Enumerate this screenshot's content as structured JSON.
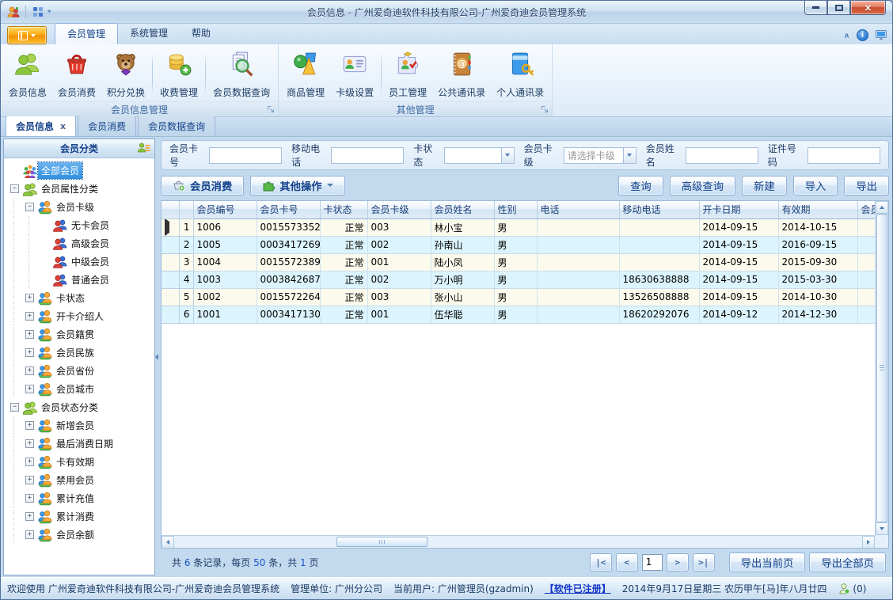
{
  "colors": {
    "accent": "#2f8fe0",
    "selection": "#3d9be9",
    "link": "#1436c8",
    "row_odd": "#fbfaec",
    "row_even": "#dcf4fd",
    "app_button": "#fcae12"
  },
  "titlebar": {
    "title": "会员信息 - 广州爱奇迪软件科技有限公司-广州爱奇迪会员管理系统"
  },
  "ribbon": {
    "tabs": [
      {
        "label": "会员管理",
        "active": true
      },
      {
        "label": "系统管理",
        "active": false
      },
      {
        "label": "帮助",
        "active": false
      }
    ],
    "groups": [
      {
        "label": "会员信息管理",
        "buttons": [
          {
            "label": "会员信息",
            "icon": "members-icon",
            "sep_after": false
          },
          {
            "label": "会员消费",
            "icon": "basket-icon",
            "sep_after": false
          },
          {
            "label": "积分兑换",
            "icon": "teddy-bear-icon",
            "sep_after": true
          },
          {
            "label": "收费管理",
            "icon": "coins-icon",
            "sep_after": true
          },
          {
            "label": "会员数据查询",
            "icon": "doc-search-icon",
            "sep_after": false
          }
        ]
      },
      {
        "label": "其他管理",
        "buttons": [
          {
            "label": "商品管理",
            "icon": "goods-icon",
            "sep_after": false
          },
          {
            "label": "卡级设置",
            "icon": "card-icon",
            "sep_after": true
          },
          {
            "label": "员工管理",
            "icon": "staff-icon",
            "sep_after": false
          },
          {
            "label": "公共通讯录",
            "icon": "address-book-icon",
            "sep_after": false
          },
          {
            "label": "个人通讯录",
            "icon": "book-key-icon",
            "sep_after": false
          }
        ]
      }
    ]
  },
  "doc_tabs": [
    {
      "label": "会员信息",
      "active": true,
      "closable": true
    },
    {
      "label": "会员消费",
      "active": false,
      "closable": false
    },
    {
      "label": "会员数据查询",
      "active": false,
      "closable": false
    }
  ],
  "sidebar": {
    "header": "会员分类",
    "tree": [
      {
        "label": "全部会员",
        "level": 0,
        "icon": "people-multi",
        "expand": "none",
        "selected": true
      },
      {
        "label": "会员属性分类",
        "level": 0,
        "icon": "people-green",
        "expand": "minus",
        "selected": false
      },
      {
        "label": "会员卡级",
        "level": 1,
        "icon": "people-pair",
        "expand": "minus",
        "selected": false
      },
      {
        "label": "无卡会员",
        "level": 2,
        "icon": "people-red",
        "expand": "none",
        "selected": false
      },
      {
        "label": "高级会员",
        "level": 2,
        "icon": "people-red",
        "expand": "none",
        "selected": false
      },
      {
        "label": "中级会员",
        "level": 2,
        "icon": "people-red",
        "expand": "none",
        "selected": false
      },
      {
        "label": "普通会员",
        "level": 2,
        "icon": "people-red",
        "expand": "none",
        "selected": false
      },
      {
        "label": "卡状态",
        "level": 1,
        "icon": "people-pair",
        "expand": "plus",
        "selected": false
      },
      {
        "label": "开卡介绍人",
        "level": 1,
        "icon": "people-pair",
        "expand": "plus",
        "selected": false
      },
      {
        "label": "会员籍贯",
        "level": 1,
        "icon": "people-pair",
        "expand": "plus",
        "selected": false
      },
      {
        "label": "会员民族",
        "level": 1,
        "icon": "people-pair",
        "expand": "plus",
        "selected": false
      },
      {
        "label": "会员省份",
        "level": 1,
        "icon": "people-pair",
        "expand": "plus",
        "selected": false
      },
      {
        "label": "会员城市",
        "level": 1,
        "icon": "people-pair",
        "expand": "plus",
        "selected": false
      },
      {
        "label": "会员状态分类",
        "level": 0,
        "icon": "people-green",
        "expand": "minus",
        "selected": false
      },
      {
        "label": "新增会员",
        "level": 1,
        "icon": "people-pair",
        "expand": "plus",
        "selected": false
      },
      {
        "label": "最后消费日期",
        "level": 1,
        "icon": "people-pair",
        "expand": "plus",
        "selected": false
      },
      {
        "label": "卡有效期",
        "level": 1,
        "icon": "people-pair",
        "expand": "plus",
        "selected": false
      },
      {
        "label": "禁用会员",
        "level": 1,
        "icon": "people-pair",
        "expand": "plus",
        "selected": false
      },
      {
        "label": "累计充值",
        "level": 1,
        "icon": "people-pair",
        "expand": "plus",
        "selected": false
      },
      {
        "label": "累计消费",
        "level": 1,
        "icon": "people-pair",
        "expand": "plus",
        "selected": false
      },
      {
        "label": "会员余额",
        "level": 1,
        "icon": "people-pair",
        "expand": "plus",
        "selected": false
      }
    ]
  },
  "filter_fields": [
    {
      "label": "会员卡号",
      "type": "text",
      "value": ""
    },
    {
      "label": "移动电话",
      "type": "text",
      "value": ""
    },
    {
      "label": "卡状态",
      "type": "select",
      "value": ""
    },
    {
      "label": "会员卡级",
      "type": "select",
      "value": "请选择卡级"
    },
    {
      "label": "会员姓名",
      "type": "text",
      "value": ""
    },
    {
      "label": "证件号码",
      "type": "text",
      "value": ""
    }
  ],
  "toolbar": {
    "member_consume_label": "会员消费",
    "other_ops_label": "其他操作",
    "right_buttons": [
      "查询",
      "高级查询",
      "新建",
      "导入",
      "导出"
    ]
  },
  "grid": {
    "columns": [
      "会员编号",
      "会员卡号",
      "卡状态",
      "会员卡级",
      "会员姓名",
      "性别",
      "电话",
      "移动电话",
      "开卡日期",
      "有效期",
      "会员"
    ],
    "align": [
      "left",
      "left",
      "right",
      "left",
      "left",
      "left",
      "left",
      "left",
      "left",
      "left",
      "left"
    ],
    "rows": [
      [
        "1006",
        "0015573352",
        "正常",
        "003",
        "林小宝",
        "男",
        "",
        "",
        "2014-09-15",
        "2014-10-15",
        ""
      ],
      [
        "1005",
        "0003417269",
        "正常",
        "002",
        "孙南山",
        "男",
        "",
        "",
        "2014-09-15",
        "2016-09-15",
        ""
      ],
      [
        "1004",
        "0015572389",
        "正常",
        "001",
        "陆小凤",
        "男",
        "",
        "",
        "2014-09-15",
        "2015-09-30",
        ""
      ],
      [
        "1003",
        "0003842687",
        "正常",
        "002",
        "万小明",
        "男",
        "",
        "18630638888",
        "2014-09-15",
        "2015-03-30",
        ""
      ],
      [
        "1002",
        "0015572264",
        "正常",
        "003",
        "张小山",
        "男",
        "",
        "13526508888",
        "2014-09-15",
        "2014-10-30",
        ""
      ],
      [
        "1001",
        "0003417130",
        "正常",
        "001",
        "伍华聪",
        "男",
        "",
        "18620292076",
        "2014-09-12",
        "2014-12-30",
        ""
      ]
    ],
    "current_row": 0
  },
  "pagination": {
    "summary_segments": [
      {
        "text": "共 ",
        "num": false
      },
      {
        "text": "6",
        "num": true
      },
      {
        "text": " 条记录，每页 ",
        "num": false
      },
      {
        "text": "50",
        "num": true
      },
      {
        "text": " 条，共 ",
        "num": false
      },
      {
        "text": "1",
        "num": true
      },
      {
        "text": " 页",
        "num": false
      }
    ],
    "first": "|<",
    "prev": "<",
    "page_value": "1",
    "next": ">",
    "last": ">|",
    "export_current": "导出当前页",
    "export_all": "导出全部页"
  },
  "statusbar": {
    "welcome": "欢迎使用 广州爱奇迪软件科技有限公司-广州爱奇迪会员管理系统",
    "org": "管理单位: 广州分公司",
    "user": "当前用户: 广州管理员(gzadmin)",
    "registered": "【软件已注册】",
    "date": "2014年9月17日星期三 农历甲午[马]年八月廿四",
    "online_count": "(0)"
  }
}
